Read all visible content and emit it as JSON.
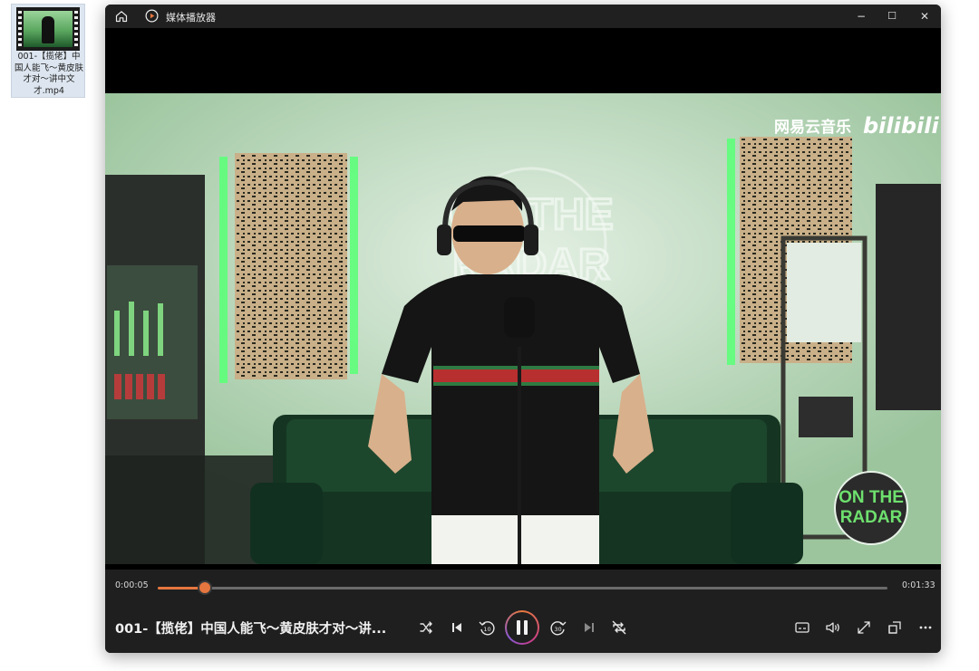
{
  "desktop": {
    "file_name": "001-【揽佬】中国人能飞～黄皮肤才对～讲中文才.mp4"
  },
  "window": {
    "title": "媒体播放器",
    "controls": {
      "minimize": "−",
      "maximize": "☐",
      "close": "✕"
    }
  },
  "video": {
    "watermark_cn": "网易云音乐",
    "watermark_brand": "bilibili",
    "wall_sign_line1": "ON THE",
    "wall_sign_line2": "RADAR",
    "corner_logo_line1": "ON THE",
    "corner_logo_line2": "RADAR"
  },
  "playback": {
    "elapsed": "0:00:05",
    "total": "0:01:33",
    "progress": 0.065,
    "now_playing": "001-【揽佬】中国人能飞～黄皮肤才对～讲..."
  },
  "icons": {
    "home": "home-icon",
    "app": "media-player-logo-icon",
    "shuffle": "shuffle-icon",
    "previous": "skip-previous-icon",
    "rewind": "rewind-10-icon",
    "pause": "pause-icon",
    "forward": "forward-30-icon",
    "next": "skip-next-icon",
    "repeat": "repeat-off-icon",
    "subtitles": "subtitles-icon",
    "volume": "volume-icon",
    "fullscreen": "fullscreen-icon",
    "miniplayer": "miniplayer-icon",
    "more": "more-icon"
  },
  "colors": {
    "accent": "#e6763f",
    "titlebar": "#202020",
    "controls_bg": "#1f1f1f"
  }
}
